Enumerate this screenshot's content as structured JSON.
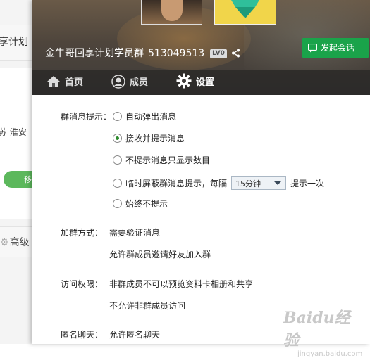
{
  "background_window": {
    "title_fragment": "享计划",
    "location_fragment": "苏 淮安",
    "button_fragment": "移",
    "advanced_fragment": "高级"
  },
  "header": {
    "group_name": "金牛哥回享计划学员群",
    "group_id": "513049513",
    "level_badge": "LV0",
    "start_chat_label": "发起会话"
  },
  "tabs": [
    {
      "label": "首页",
      "icon": "home-icon",
      "active": false
    },
    {
      "label": "成员",
      "icon": "member-icon",
      "active": false
    },
    {
      "label": "设置",
      "icon": "gear-icon",
      "active": true
    }
  ],
  "settings": {
    "notify_label": "群消息提示：",
    "notify_options": [
      {
        "label": "自动弹出消息",
        "selected": false
      },
      {
        "label": "接收并提示消息",
        "selected": true
      },
      {
        "label": "不提示消息只显示数目",
        "selected": false
      },
      {
        "label": "临时屏蔽群消息提示，每隔",
        "selected": false,
        "select_value": "15分钟",
        "suffix": "提示一次"
      },
      {
        "label": "始终不提示",
        "selected": false
      }
    ],
    "join_label": "加群方式：",
    "join_values": [
      "需要验证消息",
      "允许群成员邀请好友加入群"
    ],
    "access_label": "访问权限：",
    "access_values": [
      "非群成员不可以预览资料卡相册和共享",
      "不允许非群成员访问"
    ],
    "anon_label": "匿名聊天：",
    "anon_value": "允许匿名聊天"
  },
  "watermark": {
    "brand": "Baidu经验",
    "url": "jingyan.baidu.com"
  },
  "colors": {
    "accent_green": "#1aa34a",
    "radio_dot": "#2e8b2e"
  }
}
